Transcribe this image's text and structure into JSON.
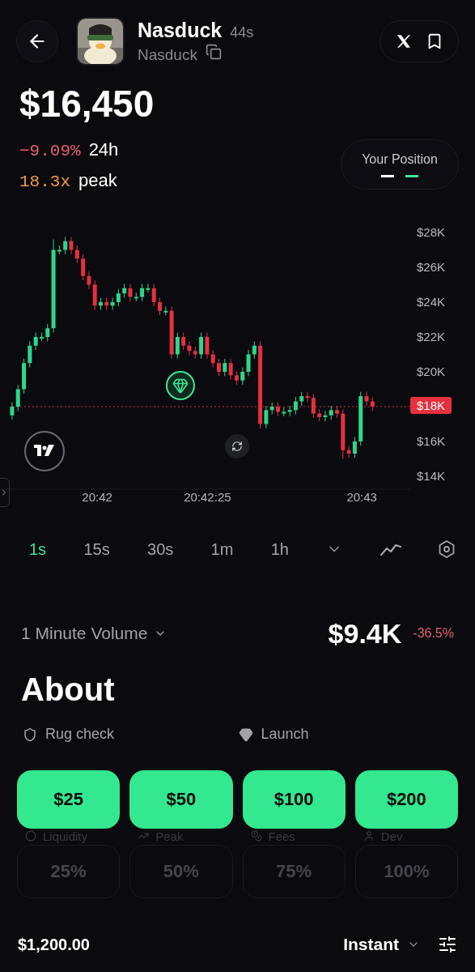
{
  "header": {
    "title": "Nasduck",
    "age": "44s",
    "ticker": "Nasduck"
  },
  "price": "$16,450",
  "change": {
    "value": "−9.09%",
    "period": "24h"
  },
  "peak": {
    "value": "18.3x",
    "label": "peak"
  },
  "position": {
    "label": "Your Position"
  },
  "chart": {
    "current_price": "$18K",
    "chart_data": {
      "type": "candlestick",
      "xlim": [
        74497.97,
        74590.97
      ],
      "ylim": [
        14,
        28
      ],
      "ref_lines": [
        {
          "axis": "y",
          "value": 18
        }
      ],
      "yticks": [
        {
          "value": 28,
          "label": "$28K"
        },
        {
          "value": 26,
          "label": "$26K"
        },
        {
          "value": 24,
          "label": "$24K"
        },
        {
          "value": 22,
          "label": "$22K"
        },
        {
          "value": 20,
          "label": "$20K"
        },
        {
          "value": 16,
          "label": "$16K"
        },
        {
          "value": 14,
          "label": "$14K"
        }
      ],
      "xticks": [
        {
          "value": 74520,
          "label": "20:42"
        },
        {
          "value": 74545,
          "label": "20:42:25"
        },
        {
          "value": 74580,
          "label": "20:43"
        }
      ],
      "x": [
        74500.71,
        74502.05,
        74503.39,
        74504.73,
        74506.07,
        74507.41,
        74508.75,
        74510.09,
        74511.43,
        74512.77,
        74514.11,
        74515.45,
        74516.79,
        74518.13,
        74519.46,
        74520.8,
        74522.14,
        74523.48,
        74524.82,
        74526.16,
        74527.5,
        74528.84,
        74530.18,
        74531.52,
        74532.86,
        74534.2,
        74535.54,
        74536.88,
        74538.21,
        74539.55,
        74540.89,
        74542.23,
        74543.57,
        74544.91,
        74546.25,
        74547.59,
        74548.93,
        74550.27,
        74551.61,
        74552.95,
        74554.29,
        74555.63,
        74556.96,
        74558.3,
        74559.64,
        74560.98,
        74562.32,
        74563.66,
        74565,
        74566.34,
        74567.68,
        74569.02,
        74570.36,
        74571.7,
        74573.04,
        74574.38,
        74575.71,
        74577.05,
        74578.39,
        74579.73,
        74581.07,
        74582.41
      ],
      "ohlc": [
        [
          17.5,
          18.25,
          17.25,
          18
        ],
        [
          18,
          19.25,
          17.75,
          19
        ],
        [
          19,
          20.75,
          18.75,
          20.5
        ],
        [
          20.5,
          21.75,
          20.25,
          21.5
        ],
        [
          21.5,
          22.25,
          21.25,
          22
        ],
        [
          22,
          22.25,
          21.75,
          22
        ],
        [
          22,
          22.75,
          21.75,
          22.5
        ],
        [
          22.5,
          27.6,
          22.25,
          27
        ],
        [
          27,
          27.25,
          26.75,
          27
        ],
        [
          27,
          27.75,
          26.75,
          27.5
        ],
        [
          27.5,
          27.75,
          26.75,
          27
        ],
        [
          27,
          27.25,
          26.25,
          26.5
        ],
        [
          26.5,
          26.75,
          25.25,
          25.5
        ],
        [
          25.5,
          25.75,
          24.75,
          25
        ],
        [
          25,
          25.25,
          23.55,
          23.8
        ],
        [
          23.8,
          24.25,
          23.55,
          24
        ],
        [
          24,
          24.25,
          23.55,
          23.8
        ],
        [
          23.8,
          24.25,
          23.55,
          24
        ],
        [
          24,
          24.75,
          23.75,
          24.5
        ],
        [
          24.5,
          25.05,
          24.25,
          24.8
        ],
        [
          24.8,
          25.05,
          24.05,
          24.3
        ],
        [
          24.3,
          24.55,
          24.05,
          24.3
        ],
        [
          24.3,
          25.05,
          24.05,
          24.8
        ],
        [
          24.8,
          25.05,
          24.55,
          24.8
        ],
        [
          24.8,
          25.05,
          23.75,
          24
        ],
        [
          24,
          24.25,
          23.25,
          23.5
        ],
        [
          23.5,
          23.75,
          23.25,
          23.5
        ],
        [
          23.5,
          23.75,
          20.75,
          21
        ],
        [
          21,
          22.25,
          20.75,
          22
        ],
        [
          22,
          22.25,
          21.25,
          21.5
        ],
        [
          21.5,
          21.75,
          20.95,
          21.2
        ],
        [
          21.2,
          21.45,
          20.75,
          21
        ],
        [
          21,
          22.25,
          20.75,
          22
        ],
        [
          22,
          22.25,
          20.75,
          21
        ],
        [
          21,
          21.25,
          20.25,
          20.5
        ],
        [
          20.5,
          20.75,
          19.75,
          20
        ],
        [
          20,
          20.75,
          19.75,
          20.5
        ],
        [
          20.5,
          20.75,
          19.55,
          19.8
        ],
        [
          19.8,
          20.05,
          19.25,
          19.5
        ],
        [
          19.5,
          20.25,
          19.25,
          20
        ],
        [
          20,
          21.25,
          19.75,
          21
        ],
        [
          21,
          21.75,
          20.75,
          21.5
        ],
        [
          21.5,
          21.75,
          16.75,
          17
        ],
        [
          17,
          18.05,
          16.75,
          17.8
        ],
        [
          17.8,
          18.25,
          17.55,
          18
        ],
        [
          18,
          18.25,
          17.45,
          17.7
        ],
        [
          17.7,
          17.95,
          17.45,
          17.7
        ],
        [
          17.7,
          18.05,
          17.45,
          17.8
        ],
        [
          17.8,
          18.55,
          17.55,
          18.3
        ],
        [
          18.3,
          18.85,
          18.05,
          18.6
        ],
        [
          18.6,
          18.85,
          18.25,
          18.5
        ],
        [
          18.5,
          18.75,
          17.35,
          17.6
        ],
        [
          17.6,
          17.85,
          17.15,
          17.4
        ],
        [
          17.4,
          17.75,
          17.15,
          17.5
        ],
        [
          17.5,
          18.05,
          17.25,
          17.8
        ],
        [
          17.8,
          18.05,
          17.35,
          17.6
        ],
        [
          17.6,
          17.85,
          15,
          15.5
        ],
        [
          15.5,
          15.75,
          15.05,
          15.3
        ],
        [
          15.3,
          16.25,
          15.05,
          16
        ],
        [
          16,
          18.85,
          15.75,
          18.6
        ],
        [
          18.6,
          18.85,
          18.05,
          18.3
        ],
        [
          18.3,
          18.55,
          17.75,
          18
        ]
      ]
    }
  },
  "timeframes": [
    {
      "label": "1s",
      "selected": true
    },
    {
      "label": "15s",
      "selected": false
    },
    {
      "label": "30s",
      "selected": false
    },
    {
      "label": "1m",
      "selected": false
    },
    {
      "label": "1h",
      "selected": false
    }
  ],
  "volume": {
    "label": "1 Minute Volume",
    "value": "$9.4K",
    "change": "-36.5%"
  },
  "about": {
    "title": "About",
    "items": [
      {
        "label": "Rug check",
        "kind": "shield"
      },
      {
        "label": "Launch",
        "kind": "gem"
      }
    ]
  },
  "quick_buy": [
    "$25",
    "$50",
    "$100",
    "$200"
  ],
  "stats": [
    {
      "label": "Liquidity",
      "kind": "liquidity"
    },
    {
      "label": "Peak",
      "kind": "peak"
    },
    {
      "label": "Fees",
      "kind": "fees"
    },
    {
      "label": "Dev",
      "kind": "dev"
    }
  ],
  "sell_percent": [
    "25%",
    "50%",
    "75%",
    "100%"
  ],
  "footer": {
    "balance": "$1,200.00",
    "mode": "Instant"
  }
}
